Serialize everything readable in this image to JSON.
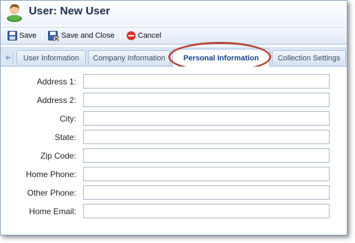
{
  "window": {
    "title": "User: New User"
  },
  "toolbar": {
    "save_label": "Save",
    "save_close_label": "Save and Close",
    "cancel_label": "Cancel"
  },
  "tabs": [
    {
      "label": "User Information",
      "active": false
    },
    {
      "label": "Company Information",
      "active": false
    },
    {
      "label": "Personal Information",
      "active": true
    },
    {
      "label": "Collection Settings",
      "active": false
    }
  ],
  "form": {
    "fields": [
      {
        "label": "Address 1:",
        "value": ""
      },
      {
        "label": "Address 2:",
        "value": ""
      },
      {
        "label": "City:",
        "value": ""
      },
      {
        "label": "State:",
        "value": ""
      },
      {
        "label": "Zip Code:",
        "value": ""
      },
      {
        "label": "Home Phone:",
        "value": ""
      },
      {
        "label": "Other Phone:",
        "value": ""
      },
      {
        "label": "Home Email:",
        "value": ""
      }
    ]
  },
  "icons": {
    "title": "user-icon",
    "save": "floppy-disk-icon",
    "save_close": "floppy-disk-close-icon",
    "cancel": "cancel-icon",
    "tab_scroll": "arrow-left-icon"
  },
  "colors": {
    "highlight": "#b8483a",
    "active_tab_text": "#15428b",
    "cancel_icon": "#d9342b"
  }
}
